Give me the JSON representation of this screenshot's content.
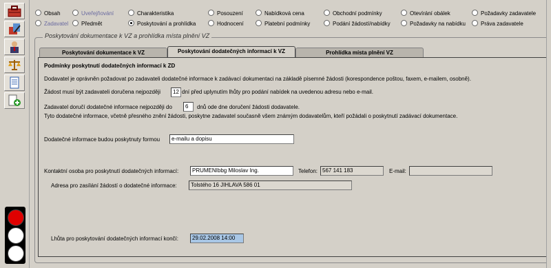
{
  "radios": {
    "row1": [
      {
        "label": "Obsah",
        "dim": false,
        "on": false
      },
      {
        "label": "Uveřejňování",
        "dim": true,
        "on": false
      },
      {
        "label": "Charakteristika",
        "dim": false,
        "on": false
      },
      {
        "label": "Posouzení",
        "dim": false,
        "on": false
      },
      {
        "label": "Nabídková cena",
        "dim": false,
        "on": false
      },
      {
        "label": "Obchodní podmínky",
        "dim": false,
        "on": false
      },
      {
        "label": "Otevírání obálek",
        "dim": false,
        "on": false
      },
      {
        "label": "Požadavky zadavatele",
        "dim": false,
        "on": false
      }
    ],
    "row2": [
      {
        "label": "Zadavatel",
        "dim": true,
        "on": false
      },
      {
        "label": "Předmět",
        "dim": false,
        "on": false
      },
      {
        "label": "Poskytování a prohlídka",
        "dim": false,
        "on": true
      },
      {
        "label": "Hodnocení",
        "dim": false,
        "on": false
      },
      {
        "label": "Platební podmínky",
        "dim": false,
        "on": false
      },
      {
        "label": "Podání žádostí/nabídky",
        "dim": false,
        "on": false
      },
      {
        "label": "Požadavky na nabídku",
        "dim": false,
        "on": false
      },
      {
        "label": "Práva zadavatele",
        "dim": false,
        "on": false
      }
    ]
  },
  "group_title": "Poskytování dokumentace k VZ a prohlídka místa plnění VZ",
  "tabs": [
    "Poskytování dokumentace k VZ",
    "Poskytování dodatečných informací k VZ",
    "Prohlídka místa plnění VZ"
  ],
  "panel": {
    "heading": "Podmínky poskytnutí dodatečných informací k ZD",
    "line1": "Dodavatel je oprávněn požadovat po zadavateli dodatečné informace k zadávací dokumentaci na základě písemné žádosti (korespondence poštou, faxem, e-mailem, osobně).",
    "line2_pre": "Žádost musí být zadavateli doručena nejpozději",
    "line2_value": "12",
    "line2_post": "dní před uplynutím lhůty pro podání nabídek na uvedenou adresu nebo e-mail.",
    "line3_pre": "Zadavatel doručí dodatečné informace nejpozději do",
    "line3_value": "6",
    "line3_post": "dnů ode dne doručení žádosti dodavatele.",
    "line4": "Tyto dodatečné informace, včetně přesného znění žádosti, poskytne zadavatel současně všem známým dodavatelům, kteří požádali o poskytnutí zadávací dokumentace.",
    "form_label": "Dodatečné informace budou poskytnuty formou",
    "form_value": "e-mailu a dopisu",
    "contact_label": "Kontaktní osoba pro poskytnutí dodatečných informací:",
    "contact_value": "PRUMENIbbg Miloslav Ing.",
    "phone_label": "Telefon:",
    "phone_value": "567 141 183",
    "email_label": "E-mail:",
    "email_value": "",
    "address_label": "Adresa pro zasílání žádostí o dodatečné informace:",
    "address_value": "Tolstého 16 JIHLAVA 586 01",
    "deadline_label": "Lhůta pro poskytování dodatečných informací končí:",
    "deadline_value": "29.02.2008 14:00"
  },
  "colors": {
    "traffic_red": "#e00000",
    "traffic_off": "#ffffff"
  }
}
